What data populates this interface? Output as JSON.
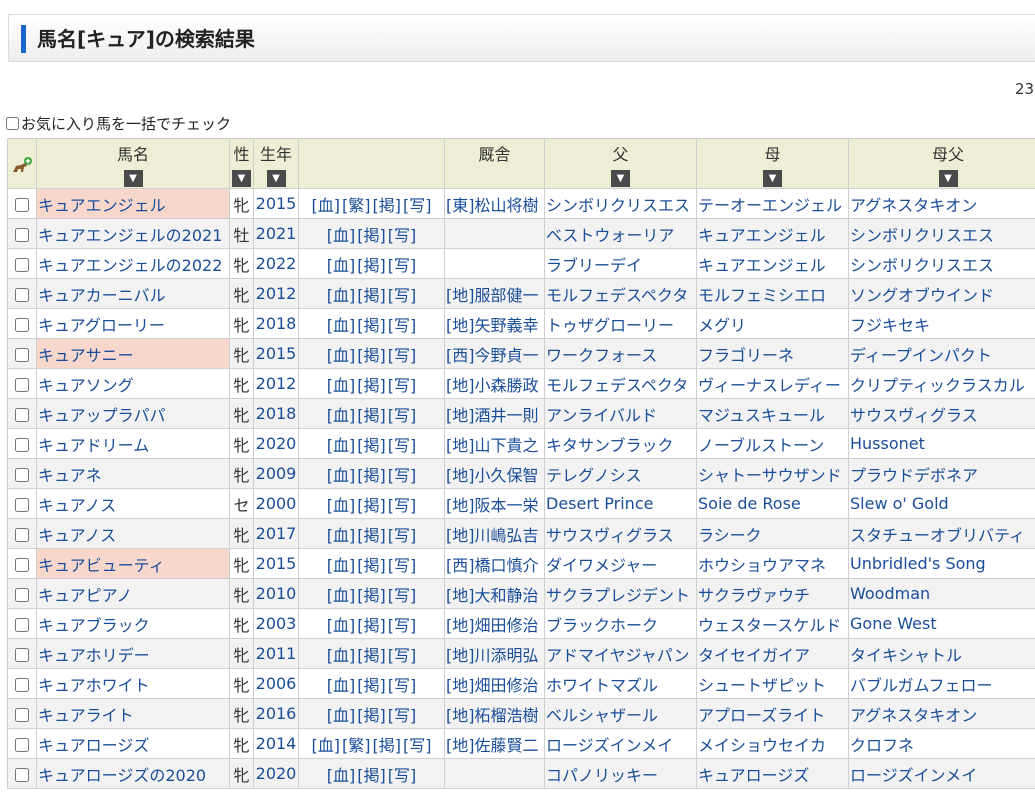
{
  "page": {
    "title": "馬名[キュア]の検索結果",
    "count": "23",
    "bulk_check_label": "お気に入り馬を一括でチェック"
  },
  "colors": {
    "accent": "#1a66cc",
    "header_bg": "#eeeed4",
    "highlight": "#f7d7cb",
    "link": "#1a4d99"
  },
  "table": {
    "headers": {
      "name": "馬名",
      "sex": "性",
      "year": "生年",
      "links": "",
      "trainer": "厩舎",
      "sire": "父",
      "dam": "母",
      "damsire": "母父"
    },
    "sort_icon": "▼",
    "fav_icon": "horse-add-icon",
    "rows": [
      {
        "name": "キュアエンジェル",
        "highlight": true,
        "sex": "牝",
        "year": "2015",
        "links": [
          "[血]",
          "[繁]",
          "[掲]",
          "[写]"
        ],
        "trainer": "[東]松山将樹",
        "sire": "シンボリクリスエス",
        "dam": "テーオーエンジェル",
        "damsire": "アグネスタキオン"
      },
      {
        "name": "キュアエンジェルの2021",
        "highlight": false,
        "sex": "牡",
        "year": "2021",
        "links": [
          "[血]",
          "[掲]",
          "[写]"
        ],
        "trainer": "",
        "sire": "ベストウォーリア",
        "dam": "キュアエンジェル",
        "damsire": "シンボリクリスエス"
      },
      {
        "name": "キュアエンジェルの2022",
        "highlight": false,
        "sex": "牝",
        "year": "2022",
        "links": [
          "[血]",
          "[掲]",
          "[写]"
        ],
        "trainer": "",
        "sire": "ラブリーデイ",
        "dam": "キュアエンジェル",
        "damsire": "シンボリクリスエス"
      },
      {
        "name": "キュアカーニバル",
        "highlight": false,
        "sex": "牝",
        "year": "2012",
        "links": [
          "[血]",
          "[掲]",
          "[写]"
        ],
        "trainer": "[地]服部健一",
        "sire": "モルフェデスペクタ",
        "dam": "モルフェミシエロ",
        "damsire": "ソングオブウインド"
      },
      {
        "name": "キュアグローリー",
        "highlight": false,
        "sex": "牝",
        "year": "2018",
        "links": [
          "[血]",
          "[掲]",
          "[写]"
        ],
        "trainer": "[地]矢野義幸",
        "sire": "トゥザグローリー",
        "dam": "メグリ",
        "damsire": "フジキセキ"
      },
      {
        "name": "キュアサニー",
        "highlight": true,
        "sex": "牝",
        "year": "2015",
        "links": [
          "[血]",
          "[掲]",
          "[写]"
        ],
        "trainer": "[西]今野貞一",
        "sire": "ワークフォース",
        "dam": "フラゴリーネ",
        "damsire": "ディープインパクト"
      },
      {
        "name": "キュアソング",
        "highlight": false,
        "sex": "牝",
        "year": "2012",
        "links": [
          "[血]",
          "[掲]",
          "[写]"
        ],
        "trainer": "[地]小森勝政",
        "sire": "モルフェデスペクタ",
        "dam": "ヴィーナスレディー",
        "damsire": "クリプティックラスカル"
      },
      {
        "name": "キュアップラパパ",
        "highlight": false,
        "sex": "牝",
        "year": "2018",
        "links": [
          "[血]",
          "[掲]",
          "[写]"
        ],
        "trainer": "[地]酒井一則",
        "sire": "アンライバルド",
        "dam": "マジュスキュール",
        "damsire": "サウスヴィグラス"
      },
      {
        "name": "キュアドリーム",
        "highlight": false,
        "sex": "牝",
        "year": "2020",
        "links": [
          "[血]",
          "[掲]",
          "[写]"
        ],
        "trainer": "[地]山下貴之",
        "sire": "キタサンブラック",
        "dam": "ノーブルストーン",
        "damsire": "Hussonet"
      },
      {
        "name": "キュアネ",
        "highlight": false,
        "sex": "牝",
        "year": "2009",
        "links": [
          "[血]",
          "[掲]",
          "[写]"
        ],
        "trainer": "[地]小久保智",
        "sire": "テレグノシス",
        "dam": "シャトーサウザンド",
        "damsire": "プラウドデボネア"
      },
      {
        "name": "キュアノス",
        "highlight": false,
        "sex": "セ",
        "year": "2000",
        "links": [
          "[血]",
          "[掲]",
          "[写]"
        ],
        "trainer": "[地]阪本一栄",
        "sire": "Desert Prince",
        "dam": "Soie de Rose",
        "damsire": "Slew o' Gold"
      },
      {
        "name": "キュアノス",
        "highlight": false,
        "sex": "牝",
        "year": "2017",
        "links": [
          "[血]",
          "[掲]",
          "[写]"
        ],
        "trainer": "[地]川嶋弘吉",
        "sire": "サウスヴィグラス",
        "dam": "ラシーク",
        "damsire": "スタチューオブリバティ"
      },
      {
        "name": "キュアビューティ",
        "highlight": true,
        "sex": "牝",
        "year": "2015",
        "links": [
          "[血]",
          "[掲]",
          "[写]"
        ],
        "trainer": "[西]橋口慎介",
        "sire": "ダイワメジャー",
        "dam": "ホウショウアマネ",
        "damsire": "Unbridled's Song"
      },
      {
        "name": "キュアピアノ",
        "highlight": false,
        "sex": "牝",
        "year": "2010",
        "links": [
          "[血]",
          "[掲]",
          "[写]"
        ],
        "trainer": "[地]大和静治",
        "sire": "サクラプレジデント",
        "dam": "サクラヴァウチ",
        "damsire": "Woodman"
      },
      {
        "name": "キュアブラック",
        "highlight": false,
        "sex": "牝",
        "year": "2003",
        "links": [
          "[血]",
          "[掲]",
          "[写]"
        ],
        "trainer": "[地]畑田修治",
        "sire": "ブラックホーク",
        "dam": "ウェスタースケルド",
        "damsire": "Gone West"
      },
      {
        "name": "キュアホリデー",
        "highlight": false,
        "sex": "牝",
        "year": "2011",
        "links": [
          "[血]",
          "[掲]",
          "[写]"
        ],
        "trainer": "[地]川添明弘",
        "sire": "アドマイヤジャパン",
        "dam": "タイセイガイア",
        "damsire": "タイキシャトル"
      },
      {
        "name": "キュアホワイト",
        "highlight": false,
        "sex": "牝",
        "year": "2006",
        "links": [
          "[血]",
          "[掲]",
          "[写]"
        ],
        "trainer": "[地]畑田修治",
        "sire": "ホワイトマズル",
        "dam": "シュートザピット",
        "damsire": "バブルガムフェロー"
      },
      {
        "name": "キュアライト",
        "highlight": false,
        "sex": "牝",
        "year": "2016",
        "links": [
          "[血]",
          "[掲]",
          "[写]"
        ],
        "trainer": "[地]柘榴浩樹",
        "sire": "ベルシャザール",
        "dam": "アプローズライト",
        "damsire": "アグネスタキオン"
      },
      {
        "name": "キュアロージズ",
        "highlight": false,
        "sex": "牝",
        "year": "2014",
        "links": [
          "[血]",
          "[繁]",
          "[掲]",
          "[写]"
        ],
        "trainer": "[地]佐藤賢二",
        "sire": "ロージズインメイ",
        "dam": "メイショウセイカ",
        "damsire": "クロフネ"
      },
      {
        "name": "キュアロージズの2020",
        "highlight": false,
        "sex": "牝",
        "year": "2020",
        "links": [
          "[血]",
          "[掲]",
          "[写]"
        ],
        "trainer": "",
        "sire": "コパノリッキー",
        "dam": "キュアロージズ",
        "damsire": "ロージズインメイ"
      }
    ]
  }
}
